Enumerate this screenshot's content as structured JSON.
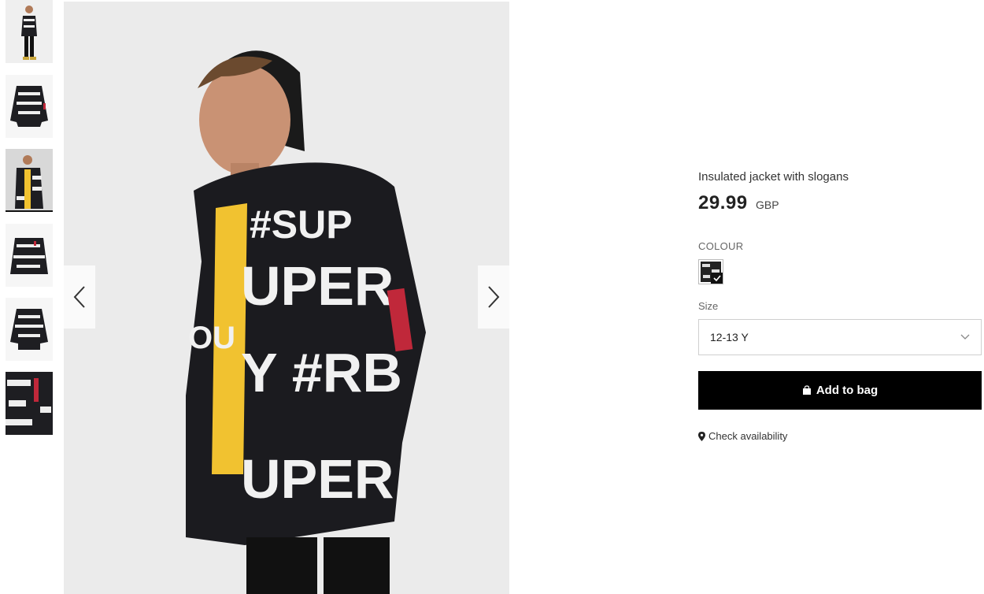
{
  "gallery": {
    "thumbnails": [
      {
        "name": "thumb-1",
        "active": false
      },
      {
        "name": "thumb-2",
        "active": false
      },
      {
        "name": "thumb-3",
        "active": true
      },
      {
        "name": "thumb-4",
        "active": false
      },
      {
        "name": "thumb-5",
        "active": false
      },
      {
        "name": "thumb-6",
        "active": false
      }
    ],
    "prev_icon": "chevron-left-icon",
    "next_icon": "chevron-right-icon"
  },
  "product": {
    "name": "Insulated jacket with slogans",
    "price": "29.99",
    "currency": "GBP",
    "colour_label": "COLOUR",
    "size_label": "Size",
    "selected_size": "12-13 Y",
    "add_to_bag_label": "Add to bag",
    "check_availability_label": "Check availability"
  },
  "colors": {
    "button_bg": "#000000",
    "button_text": "#ffffff",
    "jacket": "#1b1b1f",
    "shirt": "#f1c230"
  }
}
